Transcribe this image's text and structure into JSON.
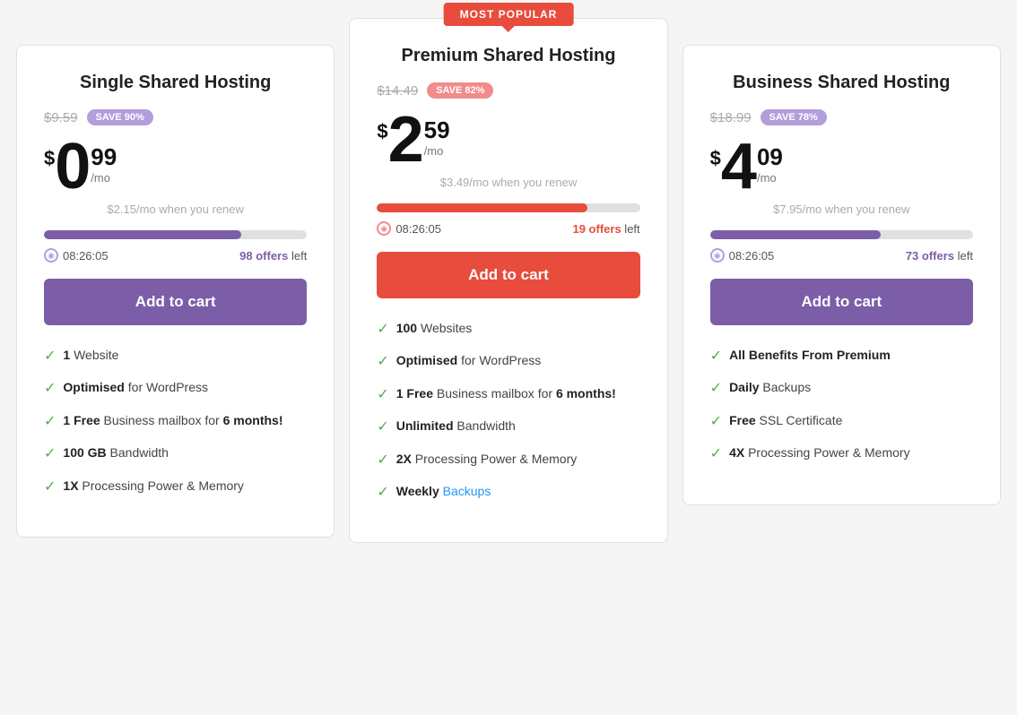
{
  "plans": [
    {
      "id": "single",
      "name": "Single Shared Hosting",
      "popular": false,
      "original_price": "$9.59",
      "save_label": "SAVE 90%",
      "save_color": "purple",
      "price_dollar": "$",
      "price_main": "0",
      "price_cents": "99",
      "price_mo": "/mo",
      "renew_price": "$2.15/mo when you renew",
      "progress_fill": 75,
      "progress_color": "purple",
      "timer": "08:26:05",
      "timer_color": "purple",
      "offers_count": "98",
      "offers_label": "offers left",
      "offers_color": "purple",
      "btn_label": "Add to cart",
      "btn_color": "purple",
      "features": [
        {
          "bold": "1",
          "rest": " Website",
          "link": false
        },
        {
          "bold": "Optimised",
          "rest": " for WordPress",
          "link": false
        },
        {
          "bold": "1 Free",
          "rest": " Business mailbox for ",
          "extra_bold": "6 months!",
          "link": false
        },
        {
          "bold": "100 GB",
          "rest": " Bandwidth",
          "link": false
        },
        {
          "bold": "1X",
          "rest": " Processing Power & Memory",
          "link": false
        }
      ]
    },
    {
      "id": "premium",
      "name": "Premium Shared Hosting",
      "popular": true,
      "popular_label": "MOST POPULAR",
      "original_price": "$14.49",
      "save_label": "SAVE 82%",
      "save_color": "red",
      "price_dollar": "$",
      "price_main": "2",
      "price_cents": "59",
      "price_mo": "/mo",
      "renew_price": "$3.49/mo when you renew",
      "progress_fill": 80,
      "progress_color": "red",
      "timer": "08:26:05",
      "timer_color": "red",
      "offers_count": "19",
      "offers_label": "offers left",
      "offers_color": "red",
      "btn_label": "Add to cart",
      "btn_color": "red",
      "features": [
        {
          "bold": "100",
          "rest": " Websites",
          "link": false
        },
        {
          "bold": "Optimised",
          "rest": " for WordPress",
          "link": false
        },
        {
          "bold": "1 Free",
          "rest": " Business mailbox for ",
          "extra_bold": "6 months!",
          "link": false
        },
        {
          "bold": "Unlimited",
          "rest": " Bandwidth",
          "link": false
        },
        {
          "bold": "2X",
          "rest": " Processing Power & Memory",
          "link": false
        },
        {
          "bold": "Weekly",
          "rest": " Backups",
          "link": true,
          "link_text": "Backups"
        }
      ]
    },
    {
      "id": "business",
      "name": "Business Shared Hosting",
      "popular": false,
      "original_price": "$18.99",
      "save_label": "SAVE 78%",
      "save_color": "purple",
      "price_dollar": "$",
      "price_main": "4",
      "price_cents": "09",
      "price_mo": "/mo",
      "renew_price": "$7.95/mo when you renew",
      "progress_fill": 65,
      "progress_color": "purple",
      "timer": "08:26:05",
      "timer_color": "purple",
      "offers_count": "73",
      "offers_label": "offers left",
      "offers_color": "purple",
      "btn_label": "Add to cart",
      "btn_color": "purple",
      "features": [
        {
          "bold": "All Benefits From Premium",
          "rest": "",
          "link": false
        },
        {
          "bold": "Daily",
          "rest": " Backups",
          "link": false
        },
        {
          "bold": "Free",
          "rest": " SSL Certificate",
          "link": false
        },
        {
          "bold": "4X",
          "rest": " Processing Power & Memory",
          "link": false
        }
      ]
    }
  ]
}
